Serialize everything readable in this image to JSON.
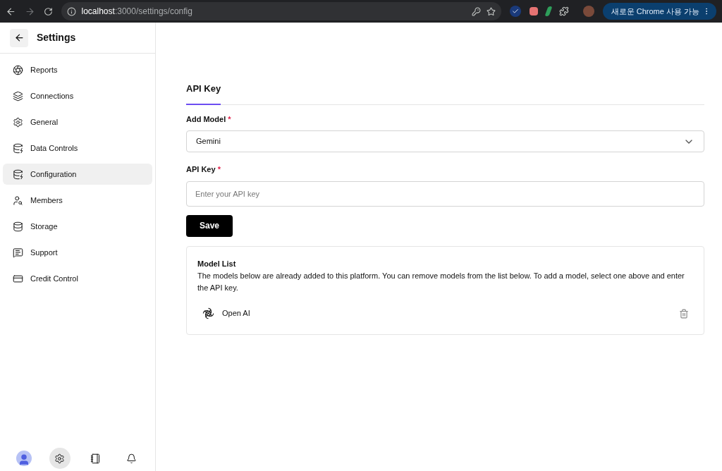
{
  "browser": {
    "url_host": "localhost",
    "url_rest": ":3000/settings/config",
    "update_button": "새로운 Chrome 사용 가능"
  },
  "sidebar": {
    "title": "Settings",
    "items": [
      {
        "label": "Reports",
        "selected": false
      },
      {
        "label": "Connections",
        "selected": false
      },
      {
        "label": "General",
        "selected": false
      },
      {
        "label": "Data Controls",
        "selected": false
      },
      {
        "label": "Configuration",
        "selected": true
      },
      {
        "label": "Members",
        "selected": false
      },
      {
        "label": "Storage",
        "selected": false
      },
      {
        "label": "Support",
        "selected": false
      },
      {
        "label": "Credit Control",
        "selected": false
      }
    ],
    "bottom": [
      {
        "kind": "avatar",
        "selected": false
      },
      {
        "kind": "settings",
        "selected": true
      },
      {
        "kind": "notebook",
        "selected": false
      },
      {
        "kind": "notifications",
        "selected": false
      }
    ]
  },
  "tabs": [
    {
      "label": "API Key",
      "selected": true
    }
  ],
  "form": {
    "model_label": "Add Model",
    "model_value": "Gemini",
    "key_label": "API Key",
    "key_placeholder": "Enter your API key",
    "required_mark": "*",
    "save": "Save"
  },
  "model_list": {
    "title": "Model List",
    "description": "The models below are already added to this platform. You can remove models from the list below. To add a model, select one above and enter the API key.",
    "models": [
      {
        "name": "Open AI"
      }
    ]
  }
}
